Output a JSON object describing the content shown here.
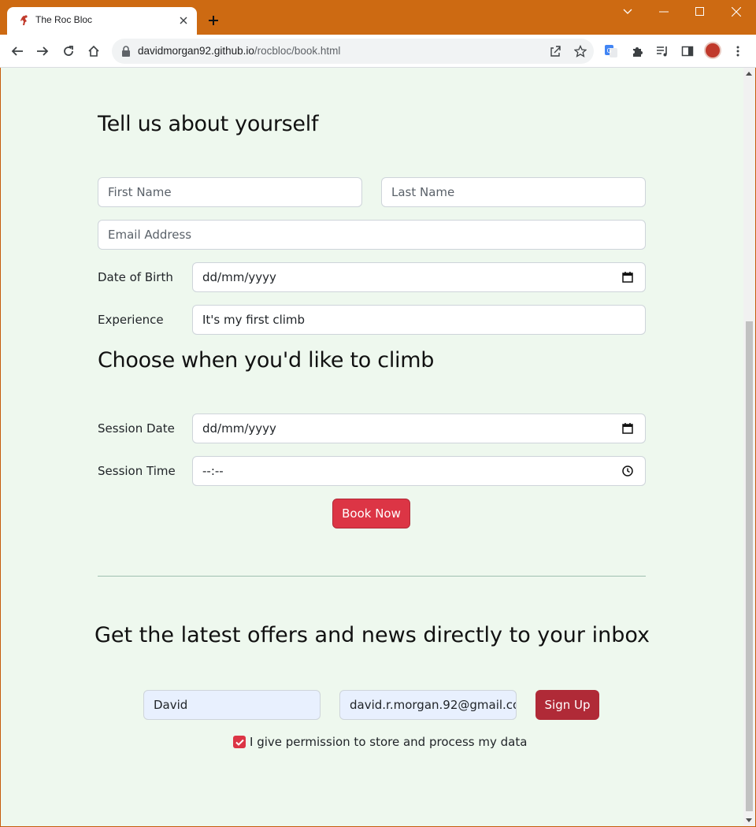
{
  "browser": {
    "tab_title": "The Roc Bloc",
    "url_host": "davidmorgan92.github.io",
    "url_path": "/rocbloc/book.html",
    "theme_color": "#cd6a12"
  },
  "about": {
    "heading": "Tell us about yourself",
    "first_name_placeholder": "First Name",
    "last_name_placeholder": "Last Name",
    "email_placeholder": "Email Address",
    "dob_label": "Date of Birth",
    "dob_value": "dd/mm/yyyy",
    "experience_label": "Experience",
    "experience_value": "It's my first climb"
  },
  "session": {
    "heading": "Choose when you'd like to climb",
    "date_label": "Session Date",
    "date_value": "dd/mm/yyyy",
    "time_label": "Session Time",
    "time_value": "--:--",
    "book_button": "Book Now"
  },
  "newsletter": {
    "heading": "Get the latest offers and news directly to your inbox",
    "name_value": "David",
    "email_value": "david.r.morgan.92@gmail.co",
    "signup_button": "Sign Up",
    "consent_label": "I give permission to store and process my data",
    "consent_checked": true
  },
  "colors": {
    "page_bg": "#eef8ee",
    "primary_button": "#dc3545",
    "signup_button": "#b02a37"
  }
}
